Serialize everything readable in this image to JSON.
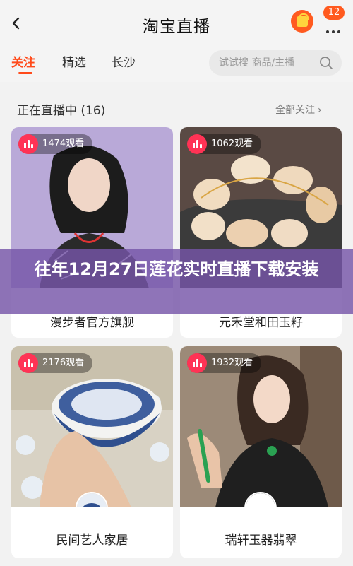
{
  "header": {
    "title": "淘宝直播",
    "badge_count": "12",
    "back_icon": "back-chevron-icon",
    "bag_icon": "shopping-bag-icon",
    "more_icon": "more-dots-icon"
  },
  "tabs": [
    {
      "label": "关注",
      "active": true
    },
    {
      "label": "精选",
      "active": false
    },
    {
      "label": "长沙",
      "active": false
    }
  ],
  "search": {
    "placeholder": "试试搜 商品/主播"
  },
  "section": {
    "title": "正在直播中 (16)",
    "follow_all": "全部关注",
    "follow_all_chevron": "›"
  },
  "cards": [
    {
      "name": "漫步者官方旗舰",
      "viewers": "1474观看"
    },
    {
      "name": "元禾堂和田玉籽",
      "viewers": "1062观看"
    },
    {
      "name": "民间艺人家居",
      "viewers": "2176观看"
    },
    {
      "name": "瑞轩玉器翡翠",
      "viewers": "1932观看"
    }
  ],
  "banner": {
    "text": "往年12月27日莲花实时直播下载安装"
  },
  "colors": {
    "accent": "#ff4a1a",
    "banner": "#7656a8",
    "live_badge": "#ff3355"
  }
}
